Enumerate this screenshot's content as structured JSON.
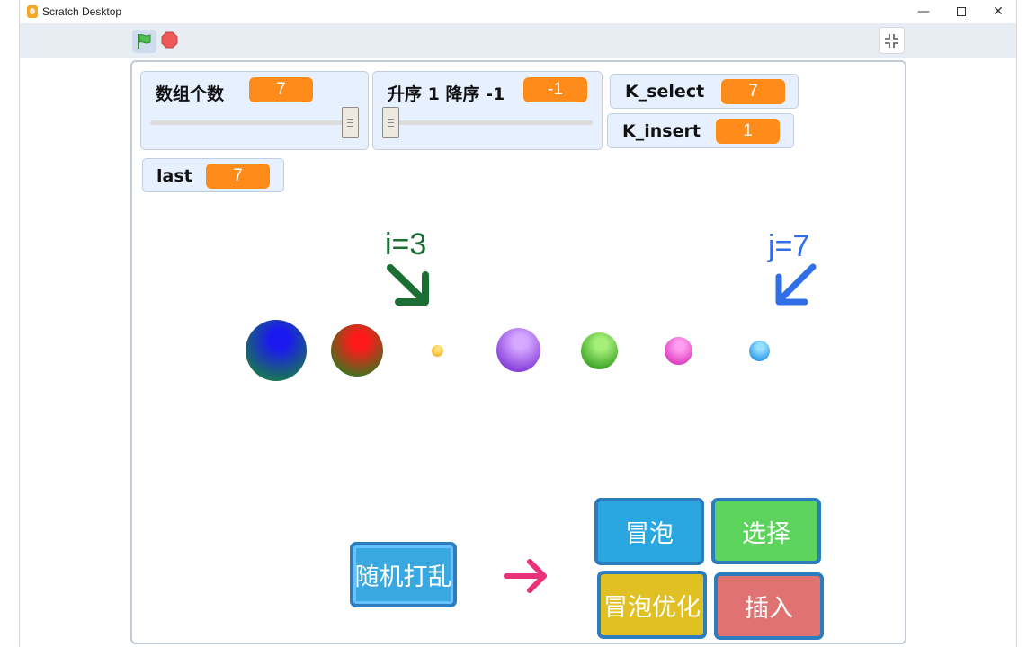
{
  "window": {
    "title": "Scratch Desktop",
    "minimize_glyph": "—",
    "close_glyph": "✕"
  },
  "toolbar": {
    "green_flag_icon": "green-flag-icon",
    "stop_icon": "stop-sign-icon",
    "fullscreen_icon": "exit-fullscreen-icon"
  },
  "monitors": {
    "array_count": {
      "label": "数组个数",
      "value": "7",
      "slider_fraction": 1.0
    },
    "sort_order": {
      "label": "升序 1 降序 -1",
      "value": "-1",
      "slider_fraction": 0.0
    },
    "k_select": {
      "label": "K_select",
      "value": "7"
    },
    "k_insert": {
      "label": "K_insert",
      "value": "1"
    },
    "last": {
      "label": "last",
      "value": "7"
    }
  },
  "pointers": {
    "i": {
      "label": "i=3",
      "color": "#1a6e34"
    },
    "j": {
      "label": "j=7",
      "color": "#2f6ee8"
    }
  },
  "balls": [
    {
      "name": "ball-1",
      "colors": [
        "#1a1af0",
        "#1a8040"
      ]
    },
    {
      "name": "ball-2",
      "colors": [
        "#ff1a1a",
        "#2e7a1e"
      ]
    },
    {
      "name": "ball-3",
      "colors": [
        "#ffe27a",
        "#f0b020"
      ]
    },
    {
      "name": "ball-4",
      "colors": [
        "#d7a8ff",
        "#7a2fd6"
      ]
    },
    {
      "name": "ball-5",
      "colors": [
        "#a6f07a",
        "#2f9a1a"
      ]
    },
    {
      "name": "ball-6",
      "colors": [
        "#ff9ef0",
        "#d62fb8"
      ]
    },
    {
      "name": "ball-7",
      "colors": [
        "#9ae0ff",
        "#1a90e8"
      ]
    }
  ],
  "buttons": {
    "shuffle": {
      "label": "随机打乱",
      "color": "#3aa8e0"
    },
    "bubble": {
      "label": "冒泡",
      "color": "#2aa6e0"
    },
    "select": {
      "label": "选择",
      "color": "#5cd35c"
    },
    "bubble_optimized": {
      "label": "冒泡优化",
      "color": "#e0c022"
    },
    "insert": {
      "label": "插入",
      "color": "#e07272"
    }
  },
  "colors": {
    "monitor_value": "#ff8c1a",
    "arrow_pink": "#e8327a"
  }
}
